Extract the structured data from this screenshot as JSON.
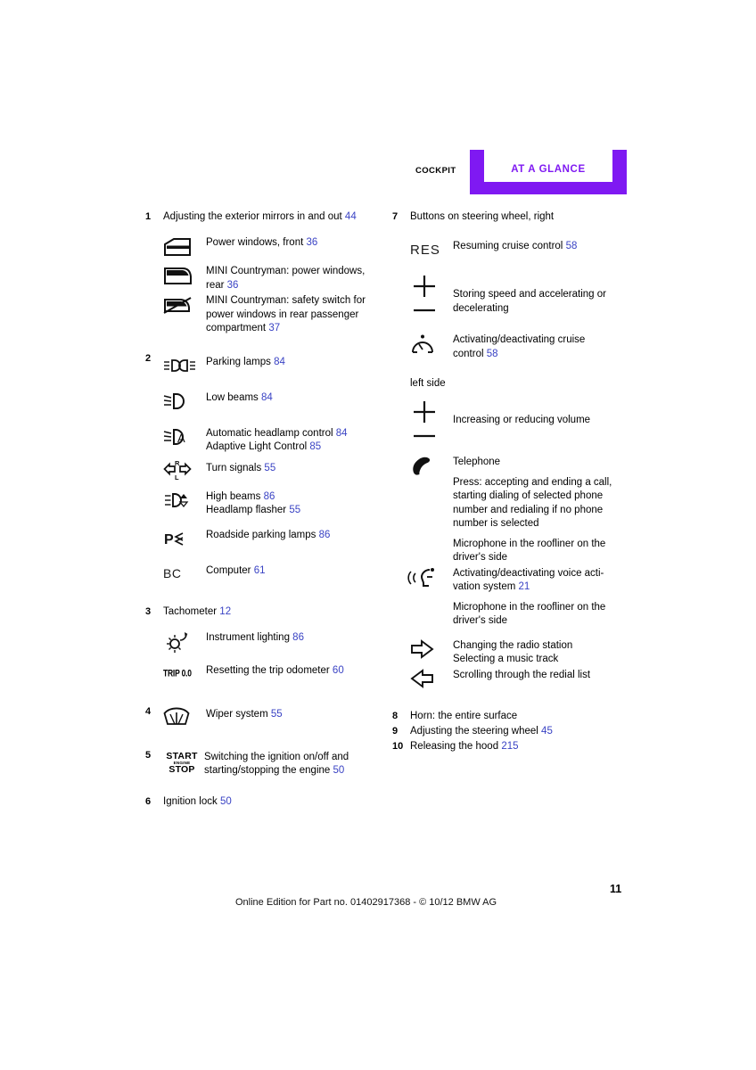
{
  "header": {
    "section_label": "COCKPIT",
    "tab_title": "AT A GLANCE",
    "tab_color": "#7F19F2"
  },
  "colors": {
    "page_ref": "#3A43C4",
    "accent": "#7F19F2",
    "text": "#000000"
  },
  "left_column": [
    {
      "number": "1",
      "label": "Adjusting the exterior mirrors in and out",
      "page": "44",
      "sub_items": [
        {
          "icon": "car-door-front-window-icon",
          "lines": [
            {
              "text": "Power windows, front",
              "page": "36"
            }
          ]
        },
        {
          "icon": "car-door-rear-window-icon",
          "lines": [
            {
              "text": "MINI Countryman: power windows,",
              "page": ""
            },
            {
              "text": "rear",
              "page": "36"
            }
          ]
        },
        {
          "icon": "power-window-safety-switch-icon",
          "lines": [
            {
              "text": "MINI Countryman: safety switch for",
              "page": ""
            },
            {
              "text": "power windows in rear passenger",
              "page": ""
            },
            {
              "text": "compartment",
              "page": "37"
            }
          ]
        }
      ]
    },
    {
      "number": "2",
      "label": "",
      "page": "",
      "sub_items": [
        {
          "icon": "parking-lamps-icon",
          "lines": [
            {
              "text": "Parking lamps",
              "page": "84"
            }
          ]
        },
        {
          "icon": "low-beams-icon",
          "lines": [
            {
              "text": "Low beams",
              "page": "84"
            }
          ]
        },
        {
          "icon": "automatic-headlamp-control-icon",
          "lines": [
            {
              "text": "Automatic headlamp control",
              "page": "84"
            },
            {
              "text": "Adaptive Light Control",
              "page": "85"
            }
          ]
        },
        {
          "icon": "turn-signals-icon",
          "lines": [
            {
              "text": "Turn signals",
              "page": "55"
            }
          ]
        },
        {
          "icon": "high-beams-flasher-icon",
          "lines": [
            {
              "text": "High beams",
              "page": "86"
            },
            {
              "text": "Headlamp flasher",
              "page": "55"
            }
          ]
        },
        {
          "icon": "roadside-parking-lamps-icon",
          "lines": [
            {
              "text": "Roadside parking lamps",
              "page": "86"
            }
          ]
        },
        {
          "icon": "onboard-computer-bc-icon",
          "icon_text": "BC",
          "lines": [
            {
              "text": "Computer",
              "page": "61"
            }
          ]
        }
      ]
    },
    {
      "number": "3",
      "label": "Tachometer",
      "page": "12",
      "sub_items": [
        {
          "icon": "instrument-lighting-icon",
          "lines": [
            {
              "text": "Instrument lighting",
              "page": "86"
            }
          ]
        },
        {
          "icon": "trip-odometer-icon",
          "icon_text": "TRIP 0.0",
          "lines": [
            {
              "text": "Resetting the trip odometer",
              "page": "60"
            }
          ]
        }
      ]
    },
    {
      "number": "4",
      "label": "",
      "page": "",
      "sub_items": [
        {
          "icon": "wiper-system-icon",
          "lines": [
            {
              "text": "Wiper system",
              "page": "55"
            }
          ]
        }
      ]
    },
    {
      "number": "5",
      "label": "",
      "page": "",
      "sub_items": [
        {
          "icon": "start-stop-engine-icon",
          "icon_text_lines": [
            "START",
            "ENGINE",
            "STOP"
          ],
          "lines": [
            {
              "text": "Switching the ignition on/off and",
              "page": ""
            },
            {
              "text": "starting/stopping the engine",
              "page": "50"
            }
          ]
        }
      ]
    },
    {
      "number": "6",
      "label": "Ignition lock",
      "page": "50",
      "sub_items": []
    }
  ],
  "right_column": {
    "item7": {
      "number": "7",
      "label_line1": "Buttons on steering wheel,",
      "label_line2": "right",
      "right_side_items": [
        {
          "icon": "resume-cruise-control-res-icon",
          "icon_text": "RES",
          "lines": [
            {
              "text": "Resuming cruise control",
              "page": "58"
            }
          ]
        },
        {
          "icon": "plus-minus-rocker-icon",
          "lines": [
            {
              "text": "Storing speed and accelerating or",
              "page": ""
            },
            {
              "text": "decelerating",
              "page": ""
            }
          ]
        },
        {
          "icon": "cruise-control-speedometer-icon",
          "lines": [
            {
              "text": "Activating/deactivating cruise",
              "page": ""
            },
            {
              "text": "control",
              "page": "58"
            }
          ]
        }
      ],
      "left_side_label": "left side",
      "left_side_items": [
        {
          "icon": "plus-minus-volume-rocker-icon",
          "lines": [
            {
              "text": "Increasing or reducing volume",
              "page": ""
            }
          ]
        },
        {
          "icon": "telephone-handset-icon",
          "lines": [
            {
              "text": "Telephone",
              "page": ""
            }
          ],
          "paragraphs": [
            [
              {
                "text": "Press: accepting and ending a call,",
                "page": ""
              },
              {
                "text": "starting dialing of selected phone",
                "page": ""
              },
              {
                "text": "number and redialing if no phone",
                "page": ""
              },
              {
                "text": "number is selected",
                "page": ""
              }
            ],
            [
              {
                "text": "Microphone in the roofliner on the",
                "page": ""
              },
              {
                "text": "driver's side",
                "page": ""
              }
            ]
          ]
        },
        {
          "icon": "voice-activation-icon",
          "lines": [
            {
              "text": "Activating/deactivating voice acti-",
              "page": ""
            },
            {
              "text": "vation system",
              "page": "21"
            }
          ],
          "paragraphs": [
            [
              {
                "text": "Microphone in the roofliner on the",
                "page": ""
              },
              {
                "text": "driver's side",
                "page": ""
              }
            ]
          ]
        },
        {
          "icon": "arrow-right-outline-icon",
          "lines": [
            {
              "text": "Changing the radio station",
              "page": ""
            },
            {
              "text": "Selecting a music track",
              "page": ""
            }
          ]
        },
        {
          "icon": "arrow-left-outline-icon",
          "lines": [
            {
              "text": "Scrolling through the redial list",
              "page": ""
            }
          ]
        }
      ]
    },
    "tail_items": [
      {
        "number": "8",
        "label": "Horn: the entire surface",
        "page": ""
      },
      {
        "number": "9",
        "label": "Adjusting the steering wheel",
        "page": "45"
      },
      {
        "number": "10",
        "label": "Releasing the hood",
        "page": "215"
      }
    ]
  },
  "footer": {
    "text": "Online Edition for Part no. 01402917368 - © 10/12 BMW AG",
    "page_number": "11"
  }
}
